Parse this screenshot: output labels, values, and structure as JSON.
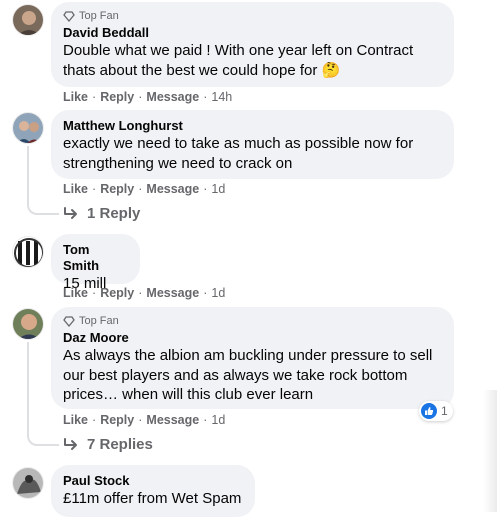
{
  "comments": [
    {
      "badge": "Top Fan",
      "author": "David Beddall",
      "text_lines": [
        "Double what we paid ! With one year left on Contract",
        "thats about the best we could hope for 🤔"
      ],
      "actions": {
        "like": "Like",
        "reply": "Reply",
        "message": "Message",
        "time": "14h"
      }
    },
    {
      "author": "Matthew Longhurst",
      "text_lines": [
        "exactly we need to take as much as possible now for",
        "strengthening we need to crack on"
      ],
      "actions": {
        "like": "Like",
        "reply": "Reply",
        "message": "Message",
        "time": "1d"
      },
      "replies_label": "1 Reply"
    },
    {
      "author": "Tom Smith",
      "text_lines": [
        "15 mill"
      ],
      "actions": {
        "like": "Like",
        "reply": "Reply",
        "message": "Message",
        "time": "1d"
      }
    },
    {
      "badge": "Top Fan",
      "author": "Daz Moore",
      "text_lines": [
        "As always the albion am buckling under pressure to sell",
        "our best players and as always we take rock bottom",
        "prices… when will this club ever learn"
      ],
      "actions": {
        "like": "Like",
        "reply": "Reply",
        "message": "Message",
        "time": "1d"
      },
      "reaction": {
        "icon": "thumbs-up-icon",
        "count": "1"
      },
      "replies_label": "7 Replies"
    },
    {
      "author": "Paul Stock",
      "text_lines": [
        "£11m offer from Wet Spam"
      ]
    }
  ],
  "separator": "·",
  "colors": {
    "bubble": "#f0f2f5",
    "secondary_text": "#65676b",
    "like_blue": "#1b74e4",
    "thread_line": "#dddfe2"
  }
}
